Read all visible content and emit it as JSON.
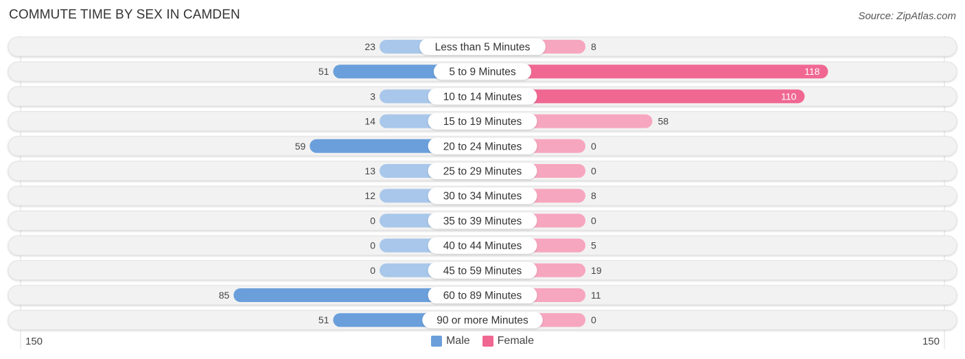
{
  "header": {
    "title": "COMMUTE TIME BY SEX IN CAMDEN",
    "source": "Source: ZipAtlas.com"
  },
  "colors": {
    "male_strong": "#6a9fdb",
    "male_light": "#a8c7ea",
    "female_strong": "#f06892",
    "female_light": "#f7a6bf",
    "row_bg": "#f2f2f2"
  },
  "chart_data": {
    "type": "bar",
    "orientation": "horizontal-diverging",
    "title": "COMMUTE TIME BY SEX IN CAMDEN",
    "categories": [
      "Less than 5 Minutes",
      "5 to 9 Minutes",
      "10 to 14 Minutes",
      "15 to 19 Minutes",
      "20 to 24 Minutes",
      "25 to 29 Minutes",
      "30 to 34 Minutes",
      "35 to 39 Minutes",
      "40 to 44 Minutes",
      "45 to 59 Minutes",
      "60 to 89 Minutes",
      "90 or more Minutes"
    ],
    "series": [
      {
        "name": "Male",
        "values": [
          23,
          51,
          3,
          14,
          59,
          13,
          12,
          0,
          0,
          0,
          85,
          51
        ]
      },
      {
        "name": "Female",
        "values": [
          8,
          118,
          110,
          58,
          0,
          0,
          8,
          0,
          5,
          19,
          11,
          0
        ]
      }
    ],
    "xlim": [
      -150,
      150
    ],
    "axis_labels": {
      "left": "150",
      "right": "150"
    },
    "legend": {
      "position": "bottom-center",
      "entries": [
        "Male",
        "Female"
      ]
    },
    "grid": false
  }
}
